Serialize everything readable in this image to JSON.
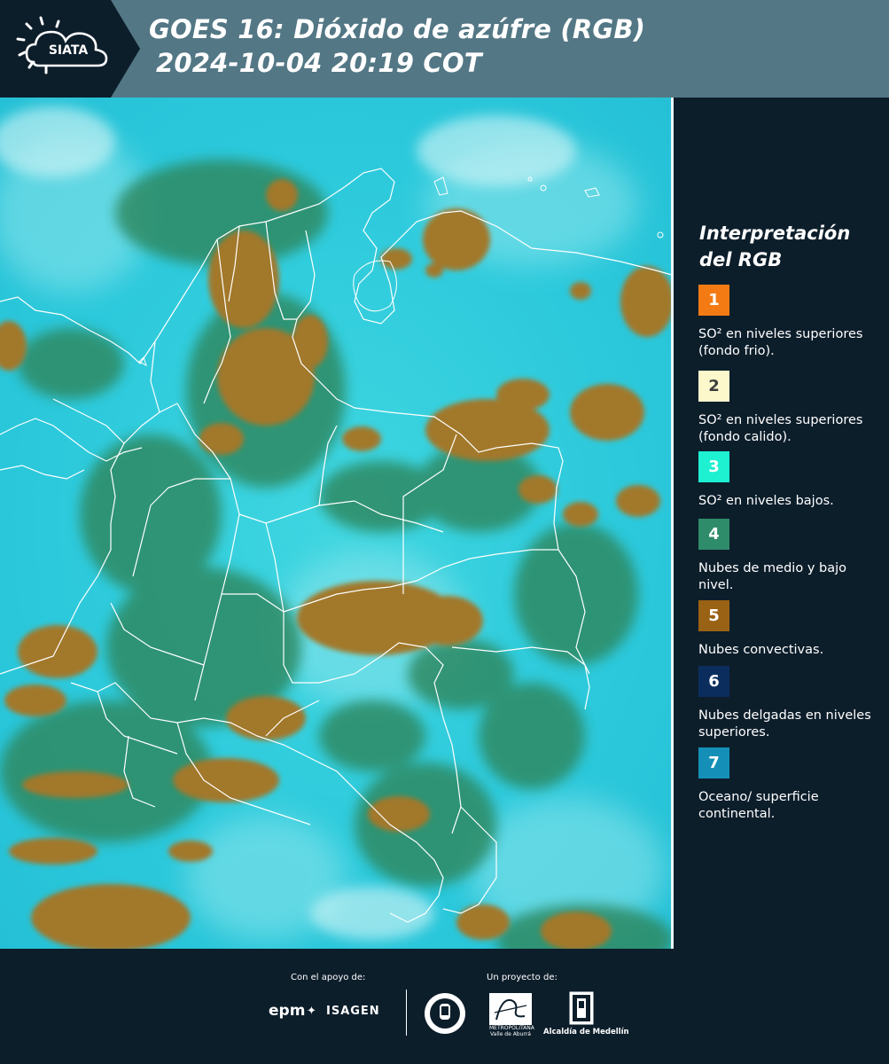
{
  "header": {
    "logo_text": "SIATA",
    "title_line1": "GOES 16: Dióxido de azúfre (RGB)",
    "title_line2": "2024-10-04 20:19 COT"
  },
  "legend": {
    "title": "Interpretación del RGB",
    "items": [
      {
        "number": "1",
        "color": "#f47b13",
        "text": "SO² en niveles superiores (fondo frio)."
      },
      {
        "number": "2",
        "color": "#fcf8cc",
        "text": "SO² en niveles superiores (fondo calido)."
      },
      {
        "number": "3",
        "color": "#1ef0d2",
        "text": "SO² en niveles bajos."
      },
      {
        "number": "4",
        "color": "#2e8c6a",
        "text": "Nubes de medio y bajo nivel."
      },
      {
        "number": "5",
        "color": "#9a6214",
        "text": "Nubes convectivas."
      },
      {
        "number": "6",
        "color": "#0b2d5e",
        "text": "Nubes delgadas en niveles superiores."
      },
      {
        "number": "7",
        "color": "#1490b8",
        "text": "Oceano/ superficie continental."
      }
    ]
  },
  "footer": {
    "support_label": "Con el apoyo de:",
    "project_label": "Un proyecto de:",
    "epm": "epm",
    "isagen": "ISAGEN",
    "area_line1": "METROPOLITANA",
    "area_line2": "Valle de Aburrá",
    "alcaldia": "Alcaldía de Medellín"
  },
  "colors": {
    "header_bg": "#537785",
    "panel_bg": "#0d1e2b",
    "map_cyan": "#2cc9dc",
    "cloud_brown": "#a2782b",
    "cloud_green": "#2f8a63"
  }
}
